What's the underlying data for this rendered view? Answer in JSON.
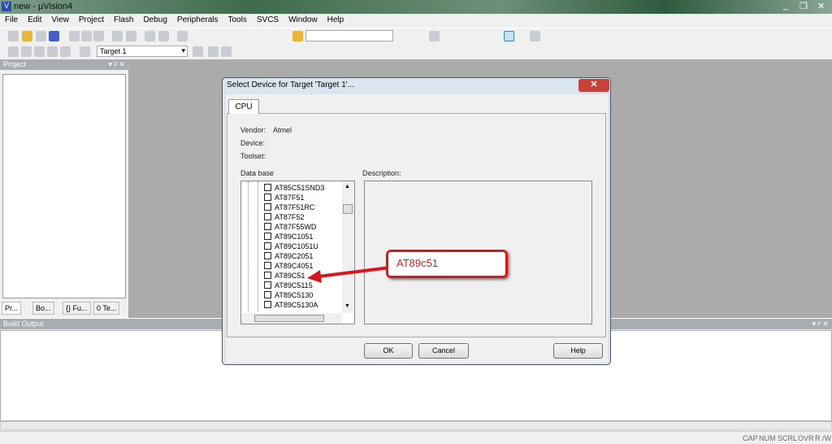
{
  "window": {
    "title": "new  - µVision4",
    "controls": [
      "_",
      "❐",
      "✕"
    ]
  },
  "menu": [
    "File",
    "Edit",
    "View",
    "Project",
    "Flash",
    "Debug",
    "Peripherals",
    "Tools",
    "SVCS",
    "Window",
    "Help"
  ],
  "toolbar": {
    "target": "Target 1"
  },
  "project_panel": {
    "title": "Project",
    "tabs": [
      "Pr...",
      "Bo...",
      "{} Fu...",
      "0 Te..."
    ]
  },
  "build_output": {
    "title": "Build Output"
  },
  "status": [
    "CAP",
    "NUM",
    "SCRL",
    "OVR",
    "R /W"
  ],
  "dialog": {
    "title": "Select Device for Target 'Target 1'...",
    "close": "✕",
    "tab": "CPU",
    "vendor_label": "Vendor:",
    "vendor": "Atmel",
    "device_label": "Device:",
    "toolset_label": "Toolset:",
    "database_label": "Data base",
    "description_label": "Description:",
    "devices": [
      "AT85C51SND3",
      "AT87F51",
      "AT87F51RC",
      "AT87F52",
      "AT87F55WD",
      "AT89C1051",
      "AT89C1051U",
      "AT89C2051",
      "AT89C4051",
      "AT89C51",
      "AT89C5115",
      "AT89C5130",
      "AT89C5130A"
    ],
    "ok": "OK",
    "cancel": "Cancel",
    "help": "Help"
  },
  "annotation": {
    "text": "AT89c51",
    "color": "#d9181e"
  }
}
